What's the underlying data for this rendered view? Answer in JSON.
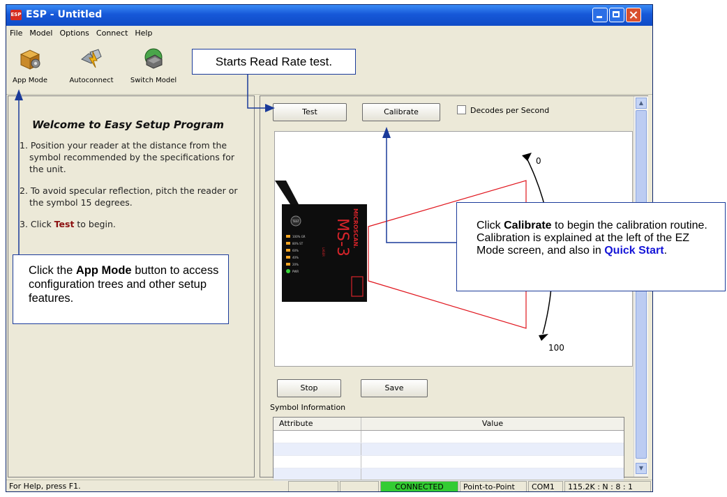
{
  "window": {
    "title": "ESP - Untitled",
    "icon_label": "ESP"
  },
  "menu": [
    "File",
    "Model",
    "Options",
    "Connect",
    "Help"
  ],
  "toolbar": {
    "items": [
      {
        "label": "App Mode",
        "icon": "app-mode-icon"
      },
      {
        "label": "Autoconnect",
        "icon": "autoconnect-icon"
      },
      {
        "label": "Switch Model",
        "icon": "switch-model-icon"
      }
    ]
  },
  "left_panel": {
    "heading": "Welcome to Easy Setup Program",
    "steps": [
      "1. Position your reader at the distance from the symbol recommended by the specifications for the unit.",
      "2. To avoid specular reflection, pitch the reader or the symbol 15 degrees."
    ],
    "step3_prefix": "3. Click ",
    "step3_keyword": "Test",
    "step3_suffix": " to begin."
  },
  "right_panel": {
    "test_button": "Test",
    "calibrate_button": "Calibrate",
    "decodes_checkbox": "Decodes per Second",
    "decodes_checked": false,
    "scale_top": "0",
    "scale_bottom": "100",
    "reader": {
      "model": "MS-3",
      "brand": "MICROSCAN.",
      "button": "TEST",
      "sublabel": "LASER",
      "leds": [
        "100% GR",
        "80% ST",
        "60%",
        "40%",
        "20%",
        "PWR"
      ]
    },
    "stop_button": "Stop",
    "save_button": "Save",
    "symbol_info_label": "Symbol Information",
    "table": {
      "columns": [
        "Attribute",
        "Value"
      ],
      "rows": [
        [
          "",
          ""
        ],
        [
          "",
          ""
        ],
        [
          "",
          ""
        ],
        [
          "",
          ""
        ]
      ]
    }
  },
  "status_bar": {
    "help": "For Help, press F1.",
    "connection": "CONNECTED",
    "mode": "Point-to-Point",
    "port": "COM1",
    "settings": "115.2K : N : 8 : 1"
  },
  "callouts": {
    "test": "Starts Read Rate test.",
    "app_mode_1": "Click the ",
    "app_mode_2": "App Mode",
    "app_mode_3": " button to access configuration trees and other setup features.",
    "calibrate_1": "Click ",
    "calibrate_2": "Calibrate",
    "calibrate_3": " to begin the calibration routine. Calibration is explained at the left of the EZ Mode screen, and also in ",
    "calibrate_4": "Quick Start",
    "calibrate_5": "."
  },
  "colors": {
    "titlebar": "#1658d8",
    "connected_bg": "#33cc33",
    "callout_border": "#1a3a9a",
    "callout_link": "#1515d8",
    "arrow": "#1a3a9a",
    "laser": "#e0141c",
    "reader_red": "#d8242a"
  }
}
